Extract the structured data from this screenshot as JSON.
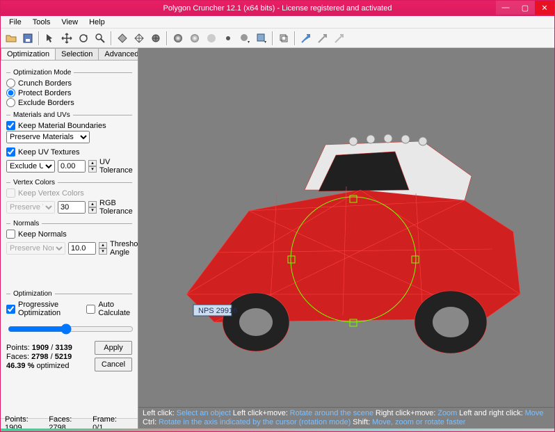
{
  "title": "Polygon Cruncher 12.1 (x64 bits) - License registered and activated",
  "menu": {
    "file": "File",
    "tools": "Tools",
    "view": "View",
    "help": "Help"
  },
  "tabs": {
    "optimization": "Optimization",
    "selection": "Selection",
    "advanced": "Advanced"
  },
  "groups": {
    "optimization_mode": "Optimization Mode",
    "materials_uvs": "Materials and UVs",
    "vertex_colors": "Vertex Colors",
    "normals": "Normals",
    "optimization": "Optimization"
  },
  "radios": {
    "crunch": "Crunch Borders",
    "protect": "Protect Borders",
    "exclude": "Exclude Borders"
  },
  "checks": {
    "keep_mat_bounds": "Keep Material Boundaries",
    "keep_uv": "Keep UV Textures",
    "keep_vc": "Keep Vertex Colors",
    "keep_normals": "Keep Normals",
    "progressive": "Progressive Optimization",
    "auto_calc": "Auto Calculate"
  },
  "combos": {
    "preserve_mat": "Preserve Materials",
    "exclude_uv": "Exclude UV",
    "preserve_vc": "Preserve VC",
    "preserve_normals": "Preserve Normals"
  },
  "labels": {
    "uv_tol": "UV Tolerance",
    "rgb_tol": "RGB Tolerance",
    "thresh_angle": "Threshold Angle",
    "points": "Points:",
    "faces": "Faces:",
    "frame": "Frame:",
    "optimized_suffix": "optimized"
  },
  "values": {
    "uv_tol": "0.00",
    "rgb_tol": "30",
    "thresh_angle": "10.0",
    "points_cur": "1909",
    "points_total": "3139",
    "faces_cur": "2798",
    "faces_total": "5219",
    "pct": "46.39 %",
    "status_points": "1909",
    "status_faces": "2798",
    "status_frame": "0/1"
  },
  "buttons": {
    "apply": "Apply",
    "cancel": "Cancel"
  },
  "hints": {
    "line1_a": "Left click:",
    "line1_b": "Select an object",
    "line1_c": "Left click+move:",
    "line1_d": "Rotate around the scene",
    "line1_e": "Right click+move:",
    "line1_f": "Zoom",
    "line1_g": "Left and right click:",
    "line1_h": "Move",
    "line2_a": "Ctrl:",
    "line2_b": "Rotate in the axis indicated by the cursor (rotation mode)",
    "line2_c": "Shift:",
    "line2_d": "Move, zoom or rotate faster"
  }
}
